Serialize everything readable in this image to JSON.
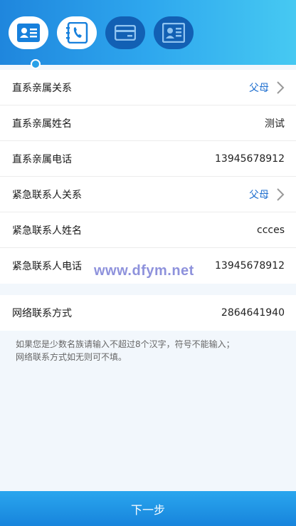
{
  "steps": [
    {
      "icon": "id-card-icon",
      "state": "active"
    },
    {
      "icon": "phone-contact-icon",
      "state": "active"
    },
    {
      "icon": "bank-card-icon",
      "state": "inactive"
    },
    {
      "icon": "profile-card-icon",
      "state": "inactive"
    }
  ],
  "relatives": [
    {
      "label": "直系亲属关系",
      "value": "父母"
    },
    {
      "label": "直系亲属姓名",
      "value": "测试"
    },
    {
      "label": "直系亲属电话",
      "value": "13945678912"
    }
  ],
  "emergency": [
    {
      "label": "紧急联系人关系",
      "value": "父母"
    },
    {
      "label": "紧急联系人姓名",
      "value": "ccces"
    },
    {
      "label": "紧急联系人电话",
      "value": "13945678912"
    }
  ],
  "network": {
    "label": "网络联系方式",
    "value": "2864641940"
  },
  "tip": "如果您是少数名族请输入不超过8个汉字，符号不能输入；\n网络联系方式如无则可不填。",
  "watermark": "www.dfym.net",
  "next_button": "下一步",
  "colors": {
    "header_start": "#1f86dd",
    "header_end": "#46c9f2",
    "link": "#1f6fcf",
    "button": "#1784dc"
  }
}
